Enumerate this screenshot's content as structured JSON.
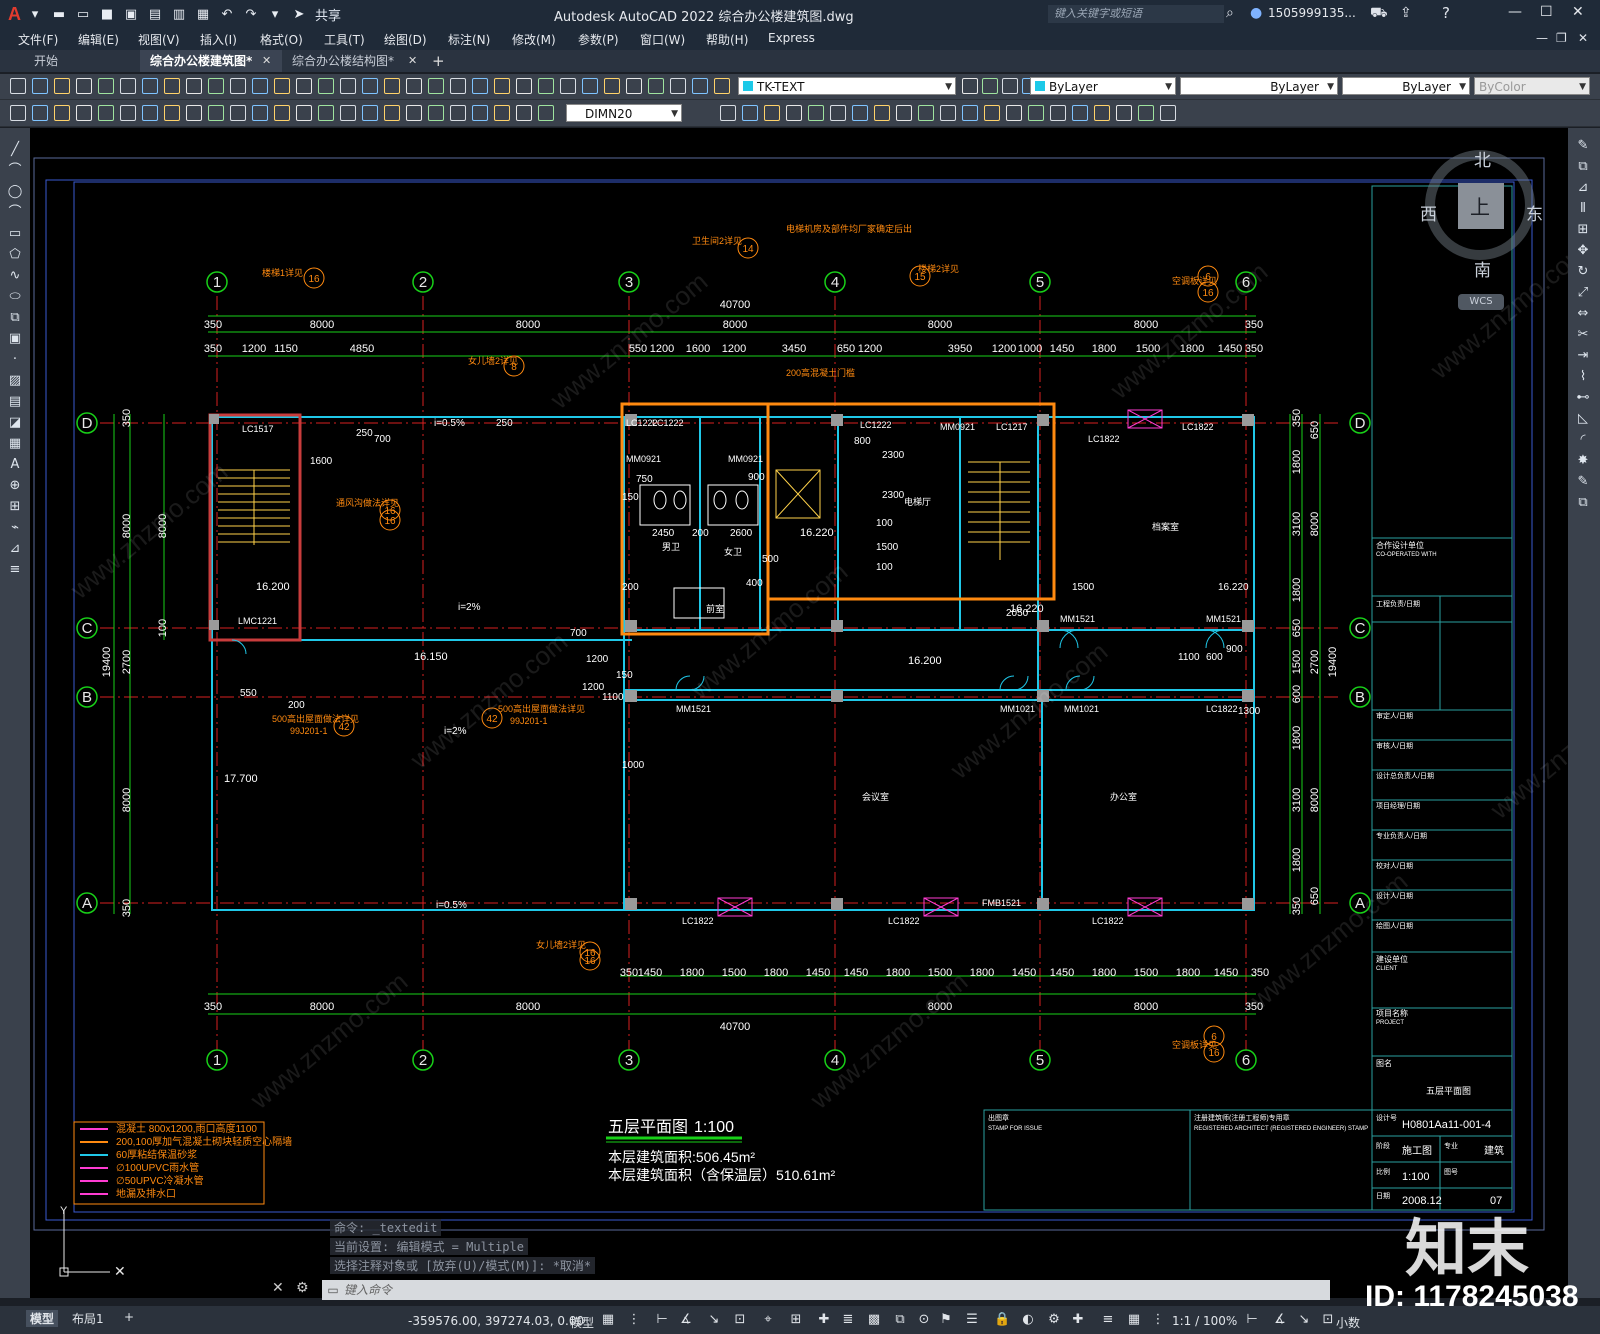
{
  "app": {
    "logo": "A",
    "share": "共享",
    "title": "Autodesk AutoCAD 2022    综合办公楼建筑图.dwg",
    "search_placeholder": "键入关键字或短语",
    "user": "1505999135...",
    "window_controls": [
      "—",
      "☐",
      "✕"
    ]
  },
  "menu": [
    "文件(F)",
    "编辑(E)",
    "视图(V)",
    "插入(I)",
    "格式(O)",
    "工具(T)",
    "绘图(D)",
    "标注(N)",
    "修改(M)",
    "参数(P)",
    "窗口(W)",
    "帮助(H)",
    "Express"
  ],
  "tabs": [
    "开始",
    "综合办公楼建筑图*",
    "综合办公楼结构图*"
  ],
  "toolbar": {
    "text_style": "TK-TEXT",
    "layer": "ByLayer",
    "linetype": "ByLayer",
    "lineweight": "ByLayer",
    "plotstyle": "ByColor",
    "dim_style": "DIMN20"
  },
  "viewcube": {
    "north": "北",
    "south": "南",
    "east": "东",
    "west": "西",
    "top": "上",
    "wcs": "WCS"
  },
  "command": {
    "history": [
      "命令: _textedit",
      "当前设置: 编辑模式 = Multiple",
      "选择注释对象或 [放弃(U)/模式(M)]: *取消*"
    ],
    "placeholder": "键入命令"
  },
  "status": {
    "layout_tabs": [
      "模型",
      "布局1",
      "+"
    ],
    "coords": "-359576.00, 397274.03, 0.00",
    "model": "模型",
    "scale": "1:1 / 100%",
    "units": "小数"
  },
  "watermark": {
    "logo": "知末",
    "id": "ID: 1178245038",
    "url": "www.znzmo.com"
  },
  "drawing": {
    "grid_top": [
      "1",
      "2",
      "3",
      "4",
      "5",
      "6"
    ],
    "grid_left": [
      "D",
      "C",
      "B",
      "A"
    ],
    "grid_right": [
      "D",
      "C",
      "B",
      "A"
    ],
    "dims_top_total": "40700",
    "dims_top_bays": [
      "350",
      "8000",
      "8000",
      "8000",
      "8000",
      "8000",
      "350"
    ],
    "dims_top_detail": [
      "350",
      "1200",
      "1150",
      "4850",
      "550",
      "1200",
      "1600",
      "1200",
      "3450",
      "650",
      "1200",
      "3950",
      "1200",
      "1000",
      "1450",
      "1800",
      "1500",
      "1800",
      "1450",
      "350"
    ],
    "dims_bottom_detail": [
      "350",
      "1450",
      "1800",
      "1500",
      "1800",
      "1450",
      "1450",
      "1800",
      "1500",
      "1800",
      "1450",
      "1450",
      "1800",
      "1500",
      "1800",
      "1450",
      "350"
    ],
    "dims_bottom_bays": [
      "350",
      "8000",
      "8000",
      "8000",
      "8000",
      "350"
    ],
    "dims_bottom_total": "40700",
    "dims_left": [
      "350",
      "8000",
      "8000",
      "100",
      "19400",
      "2700",
      "8000",
      "350"
    ],
    "dims_right": [
      "350",
      "650",
      "1800",
      "3100",
      "1800",
      "8000",
      "19400",
      "650",
      "1500",
      "2700",
      "600",
      "1800",
      "3100",
      "1800",
      "8000",
      "350",
      "650"
    ],
    "room_labels": [
      "档案室",
      "会议室",
      "办公室",
      "电梯厅",
      "男卫",
      "女卫",
      "前室"
    ],
    "elevations": [
      "16.200",
      "16.150",
      "16.200",
      "16.220",
      "16.220",
      "17.700"
    ],
    "door_tags": [
      "LC1517",
      "LMC1221",
      "LC1222",
      "LC1222",
      "LC1222",
      "MM0921",
      "MM0921",
      "LC1217",
      "LC1822",
      "LC1822",
      "MM1521",
      "MM1521",
      "MM1021",
      "MM1021",
      "MM1521",
      "LC1822",
      "LC1822",
      "LC1822",
      "LC1822",
      "FMB1521",
      "MM0921"
    ],
    "slope_labels": [
      "i=0.5%",
      "i=2%",
      "i=2%",
      "i=0.5%"
    ],
    "misc_dims": [
      "1600",
      "250",
      "700",
      "250",
      "750",
      "900",
      "150",
      "2450",
      "200",
      "2600",
      "800",
      "500",
      "2300",
      "2300",
      "400",
      "100",
      "1500",
      "100",
      "200",
      "2050",
      "1500",
      "16.220",
      "1000",
      "1300",
      "900",
      "1100",
      "600",
      "700",
      "1200",
      "150",
      "1200",
      "1100",
      "550",
      "200"
    ],
    "orange_notes": [
      "卫生间2详见",
      "电梯机房及部件均厂家确定后出",
      "楼梯2详见",
      "空调板详见",
      "楼梯1详见",
      "女儿墙2详见",
      "通风沟做法详见",
      "200高混凝土门槛",
      "500高出屋面做法详见",
      "99J201-1",
      "500高出屋面做法详见",
      "99J201-1",
      "女儿墙2详见",
      "空调板详见"
    ],
    "callouts": [
      "14",
      "15",
      "6",
      "16",
      "16",
      "8",
      "16",
      "42",
      "42",
      "16",
      "6",
      "16",
      "16",
      "16"
    ],
    "plan_title": "五层平面图",
    "plan_scale": "1:100",
    "area1": "本层建筑面积:506.45m²",
    "area2": "本层建筑面积（含保温层）510.61m²",
    "legend": [
      "混凝土 800x1200,雨口高度1100",
      "200,100厚加气混凝土砌块轻质空心隔墙",
      "60厚粘结保温砂浆",
      "∅100UPVC雨水管",
      "∅50UPVC冷凝水管",
      "地漏及排水口"
    ],
    "titleblock": {
      "coop": "合作设计单位",
      "coop_en": "CO-OPERATED WITH",
      "rows": [
        "工程负责/日期",
        "审定人/日期",
        "审核人/日期",
        "设计总负责人/日期",
        "项目经理/日期",
        "专业负责人/日期",
        "校对人/日期",
        "设计人/日期",
        "绘图人/日期"
      ],
      "client": "建设单位",
      "client_en": "CLIENT",
      "project": "项目名称",
      "project_en": "PROJECT",
      "drawing_title_lbl": "图名",
      "drawing_title": "五层平面图",
      "stamp": "出图章",
      "stamp_en": "STAMP FOR ISSUE",
      "reg": "注册建筑师(注册工程师)专用章",
      "reg_en": "REGISTERED ARCHITECT (REGISTERED ENGINEER) STAMP",
      "job_no_lbl": "设计号",
      "job_no": "H0801Aa11-001-4",
      "status_lbl": "阶段",
      "status": "施工图",
      "disc_lbl": "专业",
      "disc": "建筑",
      "scale_lbl": "比例",
      "scale": "1:100",
      "dwgno_lbl": "图号",
      "date_lbl": "日期",
      "date": "2008.12",
      "sheet": "07"
    }
  }
}
